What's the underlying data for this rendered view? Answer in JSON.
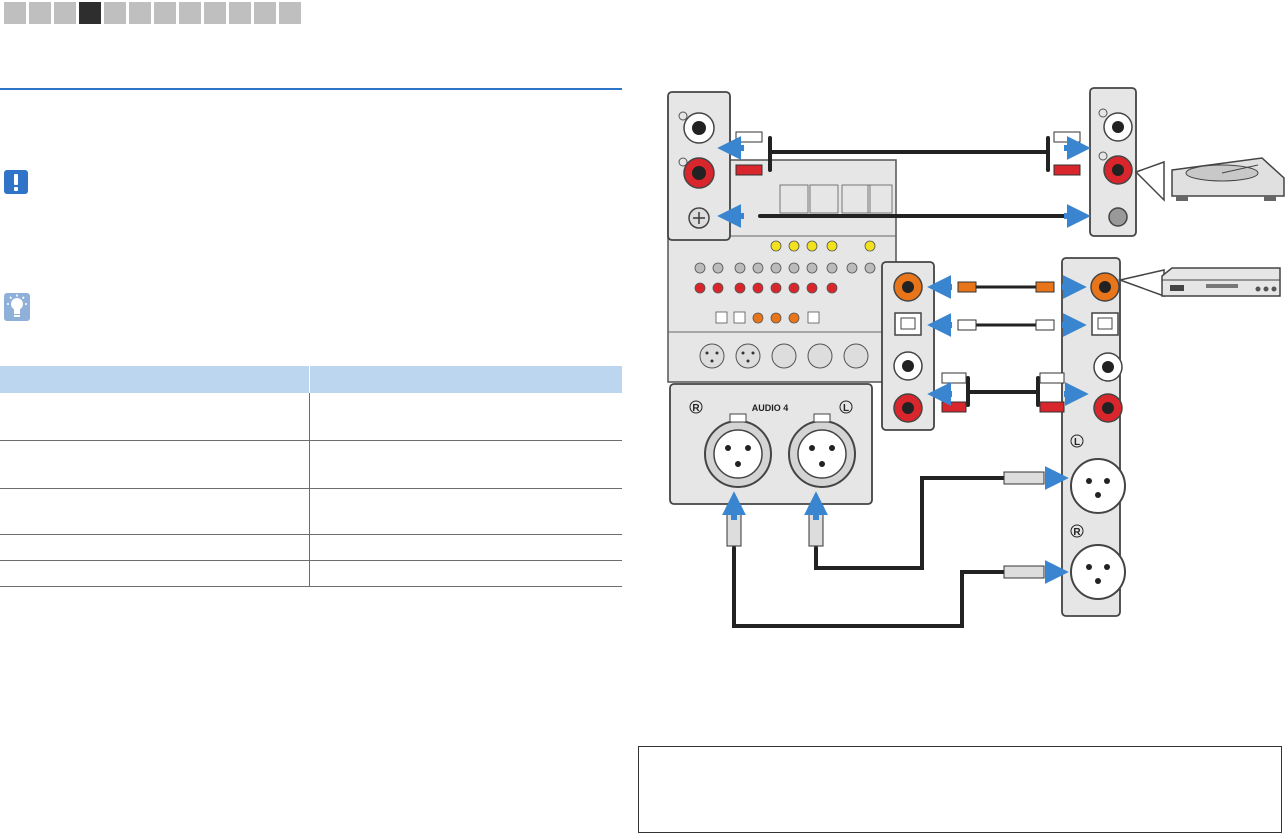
{
  "document": {
    "chapter_tabs": {
      "count": 12,
      "active_index": 3
    },
    "icons": {
      "notice": "exclamation-icon",
      "tip": "lightbulb-icon"
    },
    "table": {
      "header_color": "#bcd6ef",
      "rows": 5
    }
  },
  "diagram": {
    "labels": {
      "audio_in_label": "AUDIO 4",
      "xlr_right": "R",
      "xlr_left": "L",
      "dev_xlr_left": "L",
      "dev_xlr_right": "R"
    },
    "colors": {
      "arrow_blue": "#3a85cf",
      "rca_red": "#d9262c",
      "coax_orange": "#e8751a",
      "panel_gray": "#e6e6e6"
    },
    "devices": [
      "turntable-icon",
      "cd-player-icon"
    ]
  }
}
